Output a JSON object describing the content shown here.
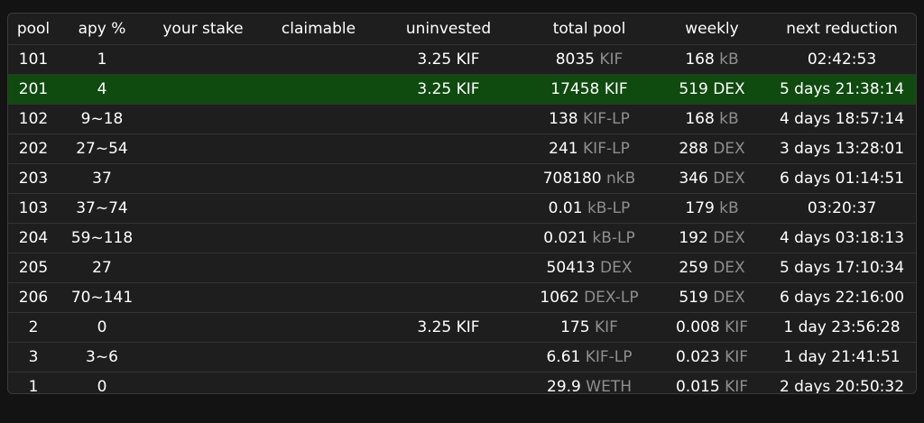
{
  "columns": [
    "pool",
    "apy %",
    "your stake",
    "claimable",
    "uninvested",
    "total pool",
    "weekly",
    "next reduction"
  ],
  "colors": {
    "background": "#131313",
    "panel": "#1e1e1e",
    "selected_row": "#0f4a0f",
    "unit_text": "#8f8f8f"
  },
  "rows": [
    {
      "pool": "101",
      "apy": "1",
      "stake": "",
      "claimable": "",
      "uninvested": "3.25 KIF",
      "total_val": "8035",
      "total_unit": "KIF",
      "weekly_val": "168",
      "weekly_unit": "kB",
      "next": "02:42:53",
      "selected": false
    },
    {
      "pool": "201",
      "apy": "4",
      "stake": "",
      "claimable": "",
      "uninvested": "3.25 KIF",
      "total_val": "17458",
      "total_unit": "KIF",
      "weekly_val": "519",
      "weekly_unit": "DEX",
      "next": "5 days 21:38:14",
      "selected": true
    },
    {
      "pool": "102",
      "apy": "9~18",
      "stake": "",
      "claimable": "",
      "uninvested": "",
      "total_val": "138",
      "total_unit": "KIF-LP",
      "weekly_val": "168",
      "weekly_unit": "kB",
      "next": "4 days 18:57:14",
      "selected": false
    },
    {
      "pool": "202",
      "apy": "27~54",
      "stake": "",
      "claimable": "",
      "uninvested": "",
      "total_val": "241",
      "total_unit": "KIF-LP",
      "weekly_val": "288",
      "weekly_unit": "DEX",
      "next": "3 days 13:28:01",
      "selected": false
    },
    {
      "pool": "203",
      "apy": "37",
      "stake": "",
      "claimable": "",
      "uninvested": "",
      "total_val": "708180",
      "total_unit": "nkB",
      "weekly_val": "346",
      "weekly_unit": "DEX",
      "next": "6 days 01:14:51",
      "selected": false
    },
    {
      "pool": "103",
      "apy": "37~74",
      "stake": "",
      "claimable": "",
      "uninvested": "",
      "total_val": "0.01",
      "total_unit": "kB-LP",
      "weekly_val": "179",
      "weekly_unit": "kB",
      "next": "03:20:37",
      "selected": false
    },
    {
      "pool": "204",
      "apy": "59~118",
      "stake": "",
      "claimable": "",
      "uninvested": "",
      "total_val": "0.021",
      "total_unit": "kB-LP",
      "weekly_val": "192",
      "weekly_unit": "DEX",
      "next": "4 days 03:18:13",
      "selected": false
    },
    {
      "pool": "205",
      "apy": "27",
      "stake": "",
      "claimable": "",
      "uninvested": "",
      "total_val": "50413",
      "total_unit": "DEX",
      "weekly_val": "259",
      "weekly_unit": "DEX",
      "next": "5 days 17:10:34",
      "selected": false
    },
    {
      "pool": "206",
      "apy": "70~141",
      "stake": "",
      "claimable": "",
      "uninvested": "",
      "total_val": "1062",
      "total_unit": "DEX-LP",
      "weekly_val": "519",
      "weekly_unit": "DEX",
      "next": "6 days 22:16:00",
      "selected": false
    },
    {
      "pool": "2",
      "apy": "0",
      "stake": "",
      "claimable": "",
      "uninvested": "3.25 KIF",
      "total_val": "175",
      "total_unit": "KIF",
      "weekly_val": "0.008",
      "weekly_unit": "KIF",
      "next": "1 day 23:56:28",
      "selected": false
    },
    {
      "pool": "3",
      "apy": "3~6",
      "stake": "",
      "claimable": "",
      "uninvested": "",
      "total_val": "6.61",
      "total_unit": "KIF-LP",
      "weekly_val": "0.023",
      "weekly_unit": "KIF",
      "next": "1 day 21:41:51",
      "selected": false
    },
    {
      "pool": "1",
      "apy": "0",
      "stake": "",
      "claimable": "",
      "uninvested": "",
      "total_val": "29.9",
      "total_unit": "WETH",
      "weekly_val": "0.015",
      "weekly_unit": "KIF",
      "next": "2 days 20:50:32",
      "selected": false
    }
  ]
}
